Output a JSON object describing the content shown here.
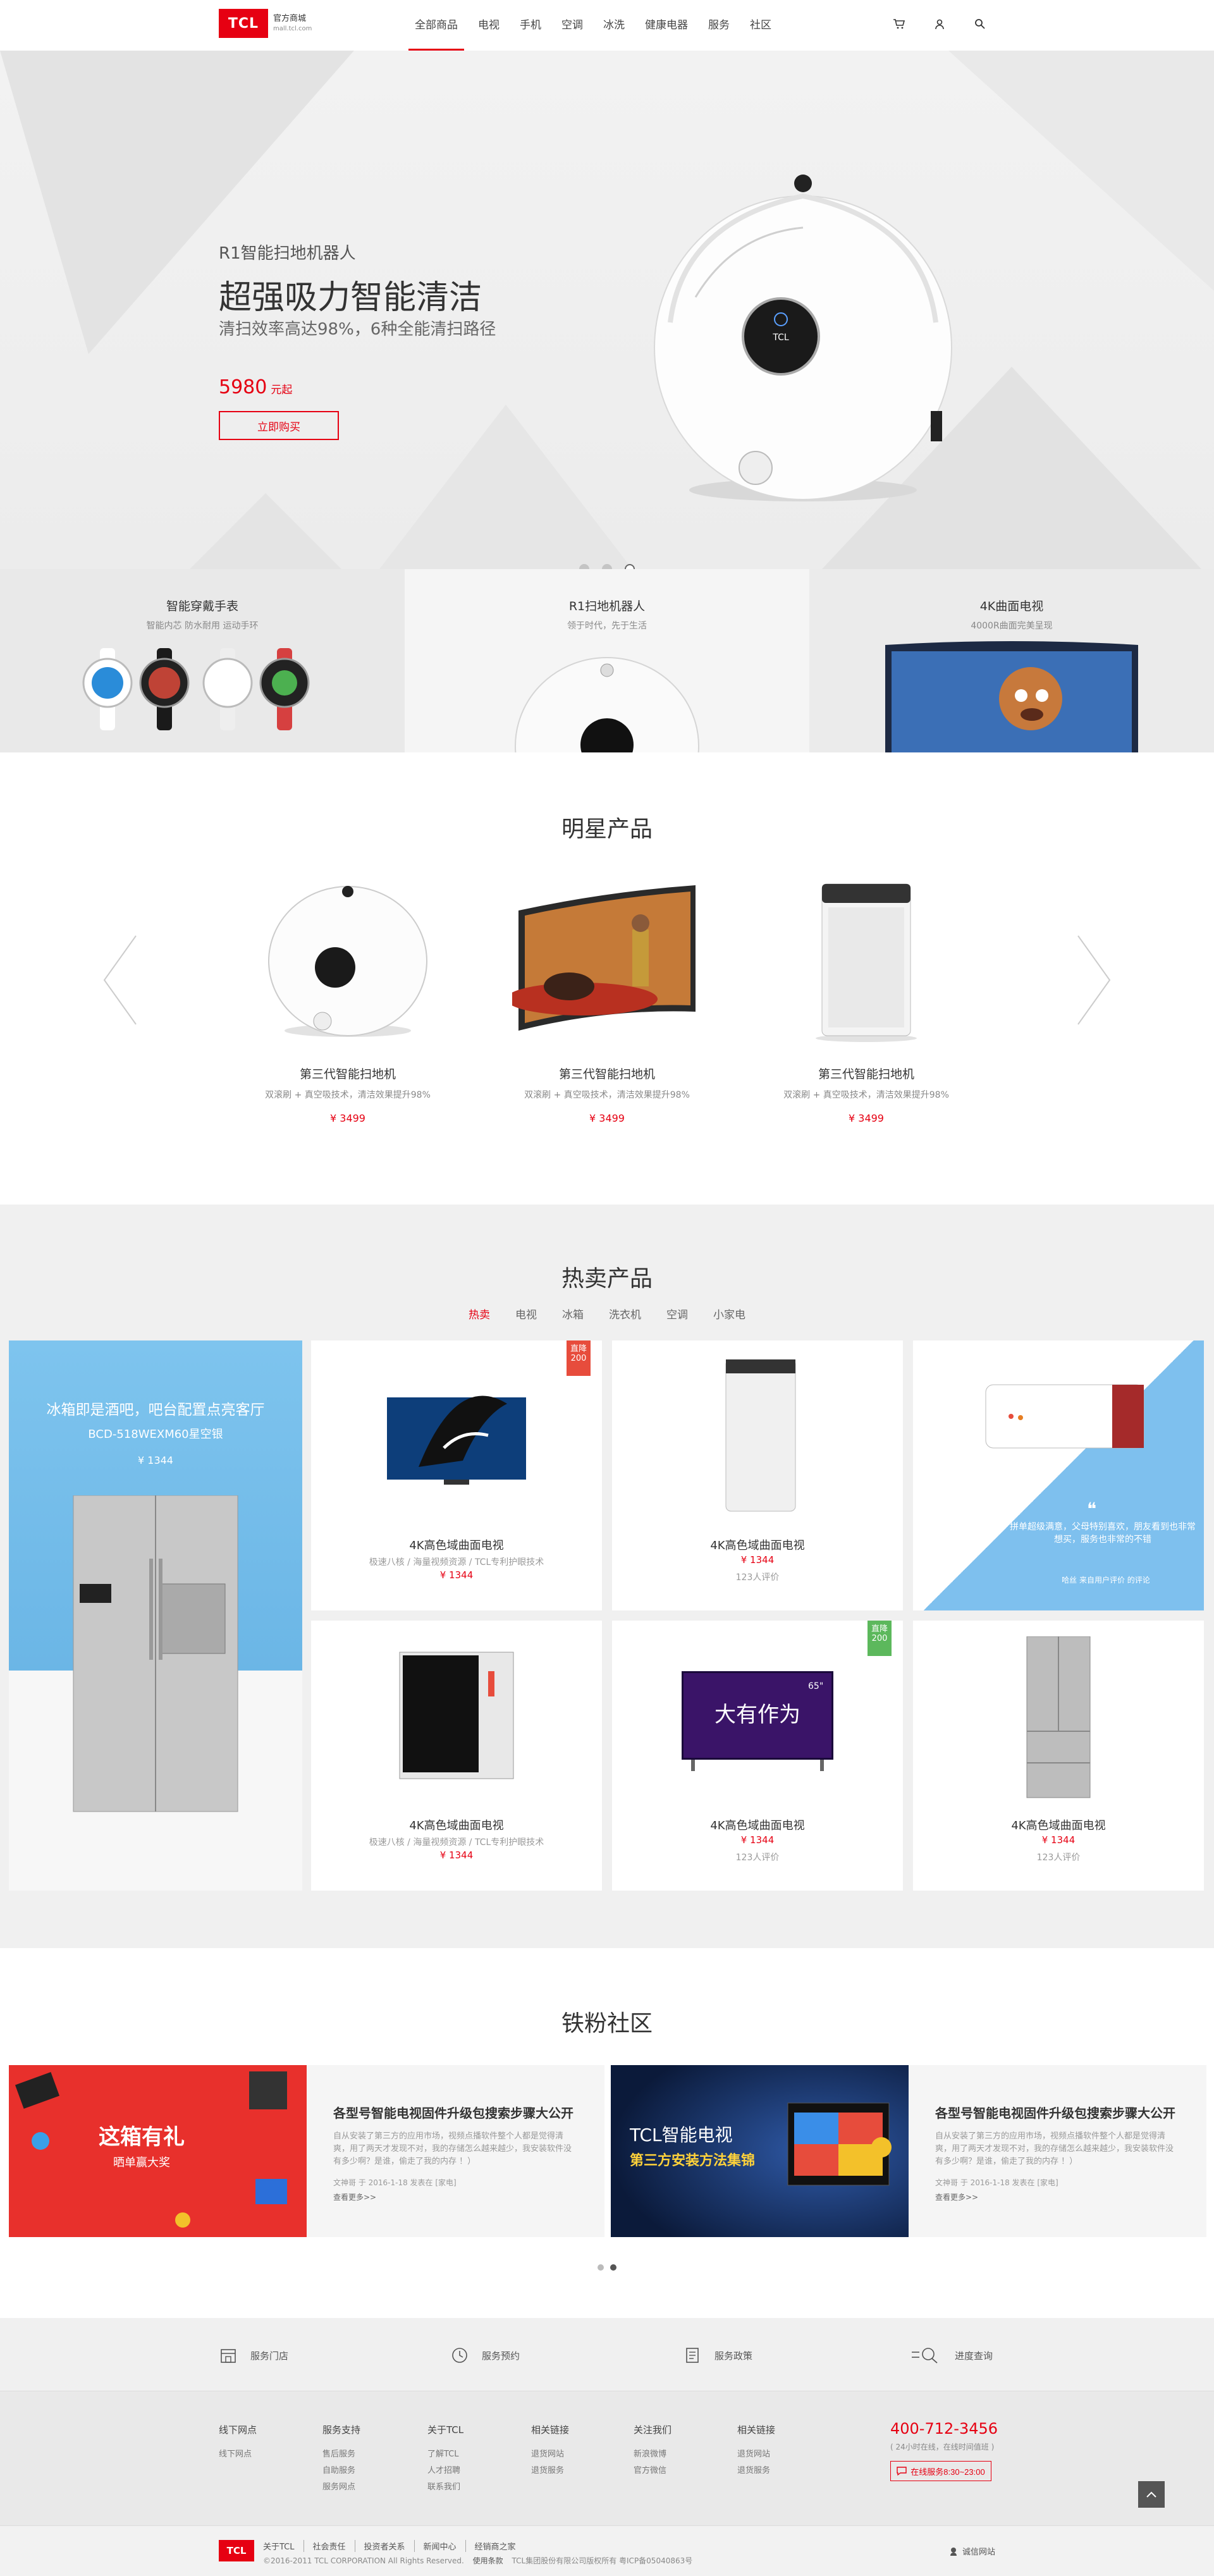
{
  "header": {
    "logo": "TCL",
    "brand_title": "官方商城",
    "brand_sub": "mall.tcl.com",
    "nav": [
      "全部商品",
      "电视",
      "手机",
      "空调",
      "冰洗",
      "健康电器",
      "服务",
      "社区"
    ]
  },
  "hero": {
    "small": "R1智能扫地机器人",
    "title": "超强吸力智能清洁",
    "desc": "清扫效率高达98%，6种全能清扫路径",
    "price": "5980",
    "price_unit": "元起",
    "button": "立即购买",
    "robot_label": "TCL"
  },
  "features": [
    {
      "title": "智能穿戴手表",
      "desc": "智能内芯 防水耐用 运动手环"
    },
    {
      "title": "R1扫地机器人",
      "desc": "领于时代，先于生活"
    },
    {
      "title": "4K曲面电视",
      "desc": "4000R曲面完美呈现"
    }
  ],
  "star": {
    "title": "明星产品",
    "items": [
      {
        "name": "第三代智能扫地机",
        "desc": "双滚刷 + 真空吸技术，清洁效果提升98%",
        "price": "¥ 3499"
      },
      {
        "name": "第三代智能扫地机",
        "desc": "双滚刷 + 真空吸技术，清洁效果提升98%",
        "price": "¥ 3499"
      },
      {
        "name": "第三代智能扫地机",
        "desc": "双滚刷 + 真空吸技术，清洁效果提升98%",
        "price": "¥ 3499"
      }
    ]
  },
  "hot": {
    "title": "热卖产品",
    "tabs": [
      "热卖",
      "电视",
      "冰箱",
      "洗衣机",
      "空调",
      "小家电"
    ],
    "big": {
      "line1": "冰箱即是酒吧，吧台配置点亮客厅",
      "line2": "BCD-518WEXM60星空银",
      "price": "¥ 1344"
    },
    "cards": [
      {
        "name": "4K高色域曲面电视",
        "sub": "极速八核 / 海量视频资源 / TCL专利护眼技术",
        "price": "¥ 1344",
        "badge": "直降200"
      },
      {
        "name": "4K高色域曲面电视",
        "price": "¥ 1344",
        "rev": "123人评价"
      },
      {
        "quote": "拼单超级满意，父母特别喜欢，朋友看到也非常想买，服务也非常的不错",
        "sig": "哈丝 来自用户评价 的评论"
      },
      {
        "name": "4K高色域曲面电视",
        "sub": "极速八核 / 海量视频资源 / TCL专利护眼技术",
        "price": "¥ 1344"
      },
      {
        "name": "4K高色域曲面电视",
        "price": "¥ 1344",
        "rev": "123人评价",
        "badge": "直降200",
        "tv_text": "大有作为",
        "tv_badge": "65\""
      },
      {
        "name": "4K高色域曲面电视",
        "price": "¥ 1344",
        "rev": "123人评价"
      }
    ]
  },
  "community": {
    "title": "铁粉社区",
    "banner1": {
      "main": "这箱有礼",
      "sub": "晒单赢大奖"
    },
    "banner2": {
      "main": "TCL智能电视",
      "sub": "第三方安装方法集锦"
    },
    "posts": [
      {
        "title": "各型号智能电视固件升级包搜索步骤大公开",
        "desc": "自从安装了第三方的应用市场，视频点播软件整个人都是觉得清爽，用了两天才发现不对，我的存储怎么越来越少，我安装软件没有多少啊？是谁，偷走了我的内存 ！）",
        "meta": "文神哥 于 2016-1-18 发表在 [家电]",
        "more": "查看更多>>"
      },
      {
        "title": "各型号智能电视固件升级包搜索步骤大公开",
        "desc": "自从安装了第三方的应用市场，视频点播软件整个人都是觉得清爽，用了两天才发现不对，我的存储怎么越来越少，我安装软件没有多少啊？是谁，偷走了我的内存 ！）",
        "meta": "文神哥 于 2016-1-18 发表在 [家电]",
        "more": "查看更多>>"
      }
    ]
  },
  "services": [
    "服务门店",
    "服务预约",
    "服务政策",
    "进度查询"
  ],
  "footer": {
    "cols": [
      {
        "title": "线下网点",
        "links": [
          "线下网点"
        ]
      },
      {
        "title": "服务支持",
        "links": [
          "售后服务",
          "自助服务",
          "服务网点"
        ]
      },
      {
        "title": "关于TCL",
        "links": [
          "了解TCL",
          "人才招聘",
          "联系我们"
        ]
      },
      {
        "title": "相关链接",
        "links": [
          "退货网站",
          "退货服务"
        ]
      },
      {
        "title": "关注我们",
        "links": [
          "新浪微博",
          "官方微信"
        ]
      },
      {
        "title": "相关链接",
        "links": [
          "退货网站",
          "退货服务"
        ]
      }
    ],
    "hotline": "400-712-3456",
    "hotline_note": "( 24小时在线，在线时间值班 )",
    "online_service": "在线服务8:30~23:00"
  },
  "bottom": {
    "logo": "TCL",
    "links": [
      "关于TCL",
      "社会责任",
      "投资者关系",
      "新闻中心",
      "经销商之家"
    ],
    "copyright": "©2016-2011 TCL CORPORATION All Rights Reserved.",
    "terms": "使用条款",
    "icp": "TCL集团股份有限公司版权所有 粤ICP备05040863号",
    "right": "诚信网站"
  },
  "colors": {
    "brand": "#e60012",
    "accent_blue": "#7ec4ee"
  }
}
